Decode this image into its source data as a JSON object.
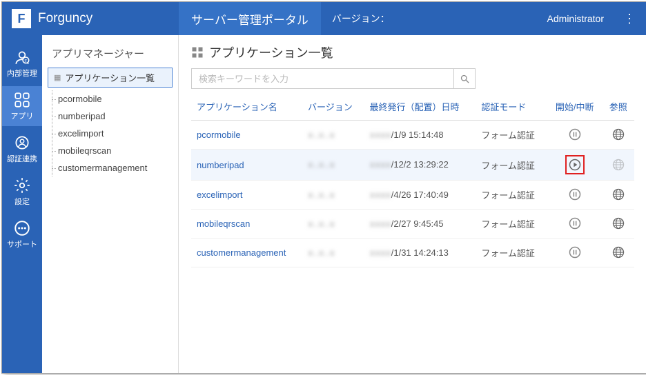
{
  "header": {
    "product": "Forguncy",
    "title": "サーバー管理ポータル",
    "version_label": "バージョン：",
    "user": "Administrator"
  },
  "nav": {
    "items": [
      {
        "id": "internal",
        "label": "内部管理"
      },
      {
        "id": "apps",
        "label": "アプリ"
      },
      {
        "id": "auth",
        "label": "認証連携"
      },
      {
        "id": "settings",
        "label": "設定"
      },
      {
        "id": "support",
        "label": "サポート"
      }
    ]
  },
  "sidebar": {
    "title": "アプリマネージャー",
    "root": "アプリケーション一覧",
    "items": [
      "pcormobile",
      "numberipad",
      "excelimport",
      "mobileqrscan",
      "customermanagement"
    ]
  },
  "main": {
    "title": "アプリケーション一覧",
    "search_placeholder": "検索キーワードを入力",
    "columns": {
      "name": "アプリケーション名",
      "version": "バージョン",
      "published": "最終発行（配置）日時",
      "auth": "認証モード",
      "action": "開始/中断",
      "browse": "参照"
    },
    "rows": [
      {
        "name": "pcormobile",
        "version_hidden": "x.x.x",
        "date_hidden": "xxxx",
        "date_tail": "/1/9 15:14:48",
        "auth": "フォーム認証",
        "state": "pause",
        "browse": true
      },
      {
        "name": "numberipad",
        "version_hidden": "x.x.x",
        "date_hidden": "xxxx",
        "date_tail": "/12/2 13:29:22",
        "auth": "フォーム認証",
        "state": "play-highlight",
        "browse": false
      },
      {
        "name": "excelimport",
        "version_hidden": "x.x.x",
        "date_hidden": "xxxx",
        "date_tail": "/4/26 17:40:49",
        "auth": "フォーム認証",
        "state": "pause",
        "browse": true
      },
      {
        "name": "mobileqrscan",
        "version_hidden": "x.x.x",
        "date_hidden": "xxxx",
        "date_tail": "/2/27 9:45:45",
        "auth": "フォーム認証",
        "state": "pause",
        "browse": true
      },
      {
        "name": "customermanagement",
        "version_hidden": "x.x.x",
        "date_hidden": "xxxx",
        "date_tail": "/1/31 14:24:13",
        "auth": "フォーム認証",
        "state": "pause",
        "browse": true
      }
    ]
  }
}
